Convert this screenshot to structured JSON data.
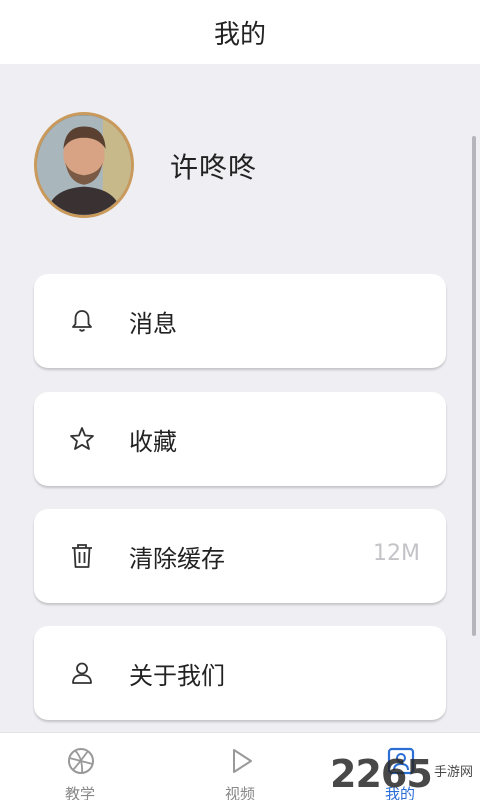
{
  "header": {
    "title": "我的"
  },
  "profile": {
    "username": "许咚咚"
  },
  "menu": [
    {
      "icon": "bell-icon",
      "label": "消息",
      "value": ""
    },
    {
      "icon": "star-icon",
      "label": "收藏",
      "value": ""
    },
    {
      "icon": "trash-icon",
      "label": "清除缓存",
      "value": "12M"
    },
    {
      "icon": "user-icon",
      "label": "关于我们",
      "value": ""
    }
  ],
  "tabs": [
    {
      "icon": "basketball-icon",
      "label": "教学",
      "active": false
    },
    {
      "icon": "play-icon",
      "label": "视频",
      "active": false
    },
    {
      "icon": "profile-icon",
      "label": "我的",
      "active": true
    }
  ],
  "watermark": {
    "number": "2265",
    "text": "手游网"
  },
  "colors": {
    "accent": "#2b6fd6",
    "background": "#efeef3",
    "avatar_ring": "#c99a5b"
  }
}
